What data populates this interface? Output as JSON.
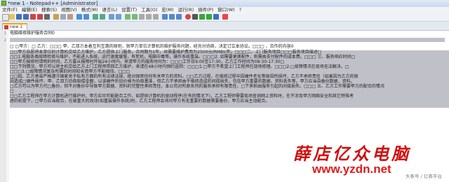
{
  "window": {
    "title": "*new 1 - Notepad++ [Administrator]"
  },
  "menu": [
    "文件(F)",
    "编辑(E)",
    "搜索(S)",
    "视图(V)",
    "格式(M)",
    "语言(L)",
    "设置(T)",
    "工具(O)",
    "宏(M)",
    "运行(R)",
    "插件(P)",
    "窗口(W)",
    "?"
  ],
  "tab": {
    "label": "new 1"
  },
  "line_numbers": [
    "1",
    "2"
  ],
  "lines": [
    "电脑维修维护服务合同0",
    "",
    "□ □甲方：□ 乙方：□□□ 甲、乙双方本着互利互惠的原则，就甲方单位计算机的维护服务问题，经充分协商，决定订立本协议。□□□ 、合作的内容0",
    "□□甲方自愿将本单位的计算机交给乙方维护，乙方提供上门服务，合同期为1年，共需要维护费用为2500元(RMB)/年。□□□二、上门服务项目□□□服务项目描述□",
    "□□1.电脑各类故障检修与维护，不能进入系统，运行速度缓慢，有死机，电脑中毒等，操作系统重装。□□□2. 如需要更换配件，则需由支付配件的成本费。□□□ 三、服务响应时间□",
    "□□甲方报修时请明的时间，乙方要从报障时开始24小时内，来请甲方的服务时间为：□□□工作日9:00至17:30，乙方工作时间为08:30-17:30□",
    "□□下列情况，甲方可以将主机交给乙方上门工程师带回乙方维护，来请在48小时内预约送回：□□□1.□甲方不希望上门工程师在现场修理。□□□2.□故障情况在现场无法解决。□",
    "□□□3.□故障情况复杂所需的时间较长而甲方不能相侍。□□□",
    "□□四、乙方承诺严格遵守国家关于私有方面的所有法律法规，绝对保密任何有关甲方的资料。□□乙方过程，在维修过程中因硬件老化等原因所损坏，乙方不承担责任（如果因为乙方的原",
    "因造成□硬件损坏，甲、乙双方协商赔偿金额，以该硬件折旧价格为协商基准，但乙方不承担由于维修造成的间接损失，包括甲方重要的数据、资料丢失等。甲方应当自备份数据，资料。",
    "□乙方可以为甲方代□备份，但不对备份中导致甲方数据、资料的完整性承担责任，本公司对所原系列的服务承担有限责任，□下承担由服务引起的间接损失。□□□ 五、乙方工作需要甲方的配合的情况",
    "□",
    "□□乙方工程师在甲方计算机进行维护时，甲方应尽可能配合工作，如提供计算机的驱动程序(在有的情况下)，乙方工程师需要现场查询网上资料时，在不涉及甲方网络安全和其它特殊考",
    "虑的前提下，□甲方应当配合，在破重大的改动(如重装操作系统)时，乙方工程师会询问甲方有无重要的数据需要备份，甲方应当主动配合。"
  ],
  "watermark": {
    "text": "薛店亿众电脑",
    "website": "www.yzdn.net",
    "credit": "头条号 / 亿商平台"
  }
}
